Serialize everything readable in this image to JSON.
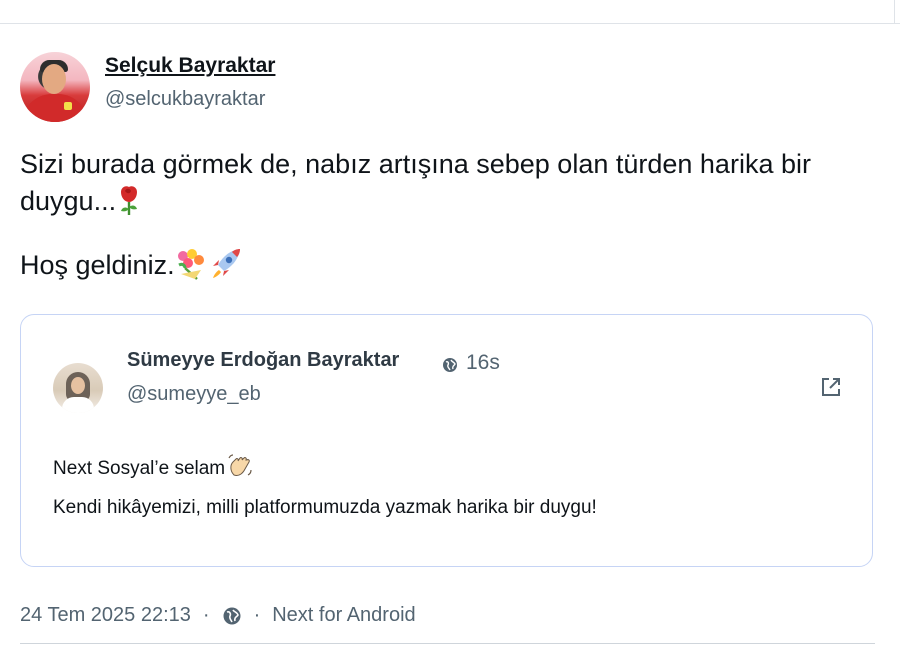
{
  "post": {
    "author_name": "Selçuk Bayraktar",
    "author_handle": "@selcukbayraktar",
    "text_line1": "Sizi burada görmek de, nabız artışına sebep olan türden harika bir",
    "text_line2": "duygu...",
    "text_line3": " Hoş geldiniz.",
    "emojis": [
      "rose-icon",
      "bouquet-icon",
      "rocket-icon"
    ]
  },
  "quote": {
    "author_name": "Sümeyye Erdoğan Bayraktar",
    "author_handle": "@sumeyye_eb",
    "time": "16s",
    "text_line1": "Next Sosyal’e selam",
    "text_line2": "Kendi hikâyemizi, milli platformumuzda yazmak harika bir duygu!",
    "icons": [
      "globe-icon",
      "external-link-icon",
      "waving-hand-icon"
    ]
  },
  "meta": {
    "timestamp": "24 Tem 2025 22:13",
    "separator": "·",
    "client": "Next for Android"
  },
  "colors": {
    "text": "#0f1419",
    "secondary": "#536471",
    "card_border": "#c6d4f5"
  }
}
